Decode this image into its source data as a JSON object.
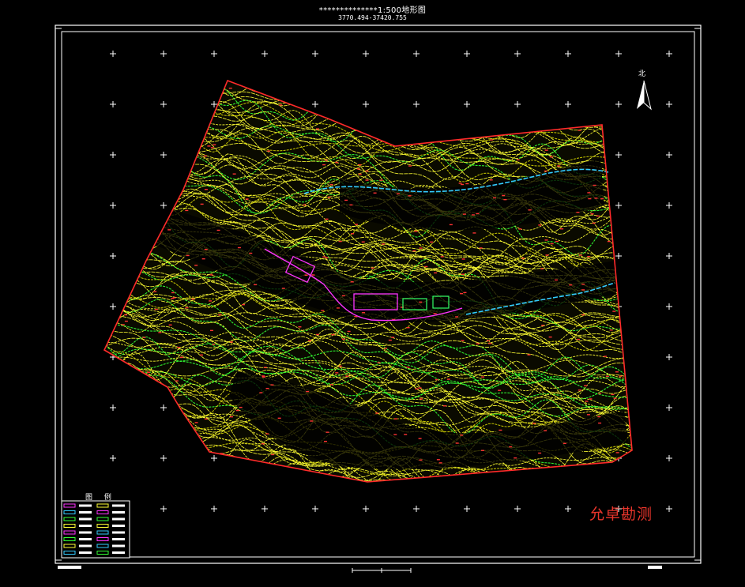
{
  "map": {
    "title": "**************1:500地形图",
    "subtitle": "3770.494-37420.755",
    "north_label": "北",
    "legend_title": "图 例",
    "watermark": "允卓勘测"
  },
  "colors": {
    "background": "#000000",
    "frame": "#ffffff",
    "boundary": "#ff2a2a",
    "contour_major": "#ffff33",
    "contour_minor": "#c8c800",
    "contour_index": "#33ff33",
    "river": "#33ccff",
    "road": "#ff33ff",
    "elevation_points": "#ff3333",
    "watermark": "#e8352b"
  },
  "icons": {
    "north_arrow": "north-arrow-icon",
    "grid_cross": "grid-cross-icon"
  }
}
